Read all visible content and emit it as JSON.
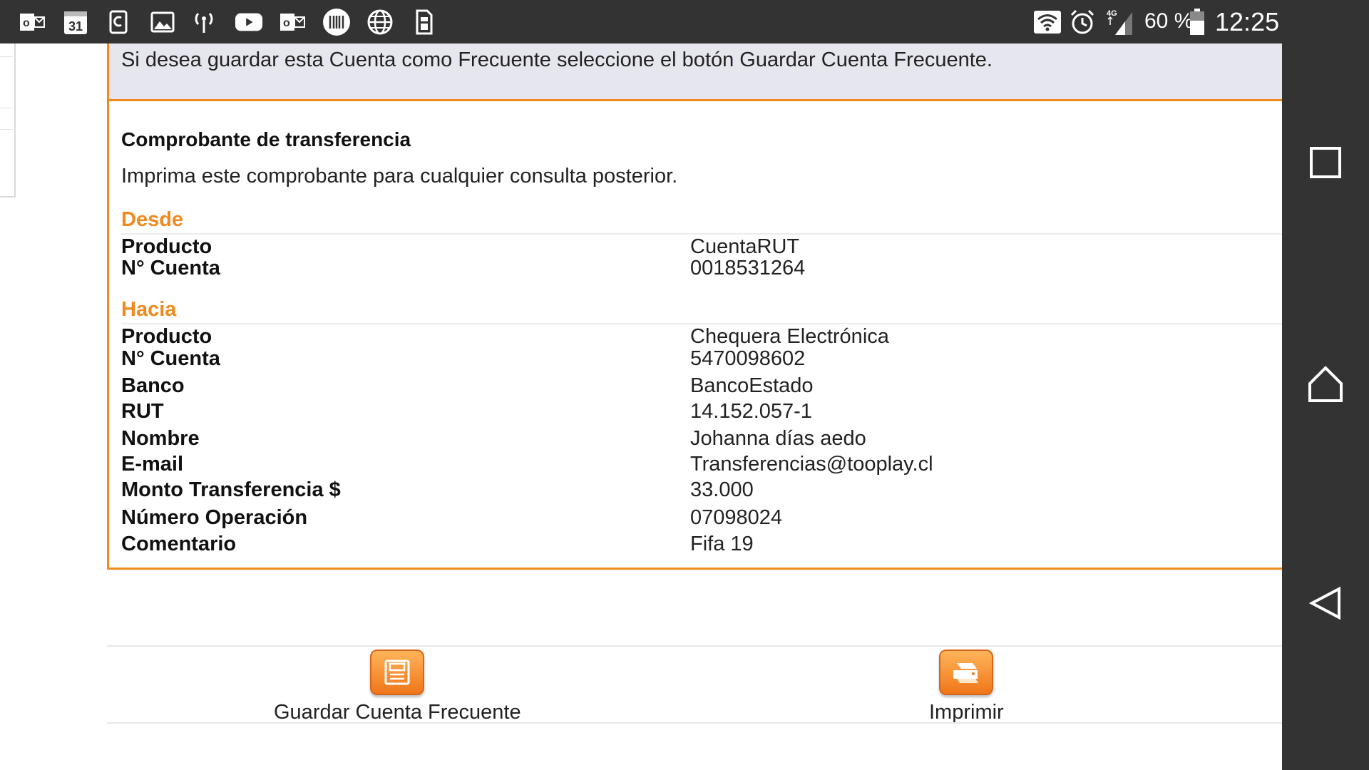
{
  "status_bar": {
    "left_icons": [
      "outlook-icon",
      "calendar-icon",
      "clip-icon",
      "gallery-icon",
      "hotspot-icon",
      "youtube-icon",
      "outlook-icon",
      "barcode-icon",
      "globe-icon",
      "sim-icon"
    ],
    "calendar_day": "31",
    "network_type": "4G",
    "battery": "60 %",
    "time": "12:25"
  },
  "notice": {
    "text": "Si desea guardar esta Cuenta como Frecuente seleccione el botón Guardar Cuenta Frecuente."
  },
  "receipt": {
    "title": "Comprobante de transferencia",
    "subtitle": "Imprima este comprobante para cualquier consulta posterior.",
    "from": {
      "heading": "Desde",
      "rows": [
        {
          "label": "Producto",
          "value": "CuentaRUT"
        },
        {
          "label": "N° Cuenta",
          "value": "0018531264"
        }
      ]
    },
    "to": {
      "heading": "Hacia",
      "rows": [
        {
          "label": "Producto",
          "value": "Chequera Electrónica"
        },
        {
          "label": "N° Cuenta",
          "value": "5470098602"
        },
        {
          "label": "Banco",
          "value": "BancoEstado"
        },
        {
          "label": "RUT",
          "value": "14.152.057-1"
        },
        {
          "label": "Nombre",
          "value": "Johanna días aedo"
        },
        {
          "label": "E-mail",
          "value": "Transferencias@tooplay.cl"
        },
        {
          "label": "Monto Transferencia $",
          "value": "33.000"
        },
        {
          "label": "Número Operación",
          "value": "07098024"
        },
        {
          "label": "Comentario",
          "value": "Fifa 19"
        }
      ]
    }
  },
  "actions": {
    "save_label": "Guardar Cuenta Frecuente",
    "print_label": "Imprimir"
  },
  "colors": {
    "accent": "#f08a1f",
    "notice_bg": "#e6e6ee",
    "system_bar": "#333333"
  }
}
